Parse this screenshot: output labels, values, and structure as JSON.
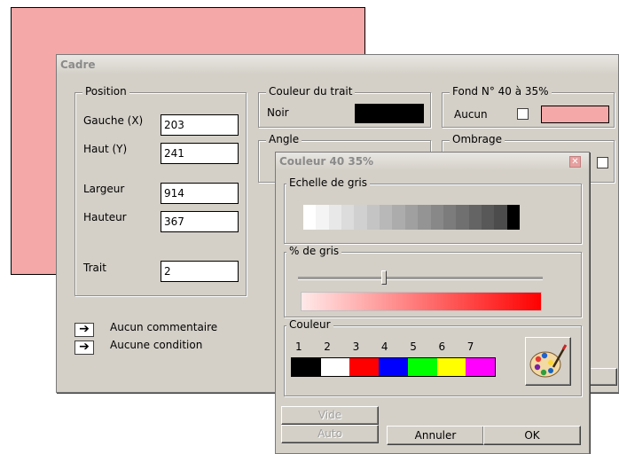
{
  "cadre": {
    "title": "Cadre",
    "position": {
      "label": "Position",
      "gauche_label": "Gauche (X)",
      "gauche_value": "203",
      "haut_label": "Haut (Y)",
      "haut_value": "241",
      "largeur_label": "Largeur",
      "largeur_value": "914",
      "hauteur_label": "Hauteur",
      "hauteur_value": "367",
      "trait_label": "Trait",
      "trait_value": "2"
    },
    "couleur_trait": {
      "label": "Couleur du trait",
      "value": "Noir",
      "swatch": "#000000"
    },
    "fond": {
      "label": "Fond N° 40 à 35%",
      "aucun_label": "Aucun",
      "swatch": "#f5a8a8"
    },
    "angle": {
      "label": "Angle"
    },
    "ombrage": {
      "label": "Ombrage"
    },
    "links": [
      "Aucun commentaire",
      "Aucune condition"
    ]
  },
  "couleur_dialog": {
    "title": "Couleur 40 35%",
    "echelle_label": "Echelle de gris",
    "gray_scale": [
      "#ffffff",
      "#f4f4f4",
      "#e8e8e8",
      "#dcdcdc",
      "#d0d0d0",
      "#c4c4c4",
      "#b8b8b8",
      "#acacac",
      "#a0a0a0",
      "#949494",
      "#888888",
      "#7c7c7c",
      "#707070",
      "#646464",
      "#585858",
      "#4c4c4c",
      "#000000"
    ],
    "pct_gris_label": "% de gris",
    "pct_gris_value": 0.35,
    "couleur_label": "Couleur",
    "color_numbers": [
      "1",
      "2",
      "3",
      "4",
      "5",
      "6",
      "7"
    ],
    "colors": [
      "#000000",
      "#ffffff",
      "#ff0000",
      "#0000ff",
      "#00ff00",
      "#ffff00",
      "#ff00ff"
    ],
    "buttons": {
      "vide": "Vide",
      "auto": "Auto",
      "annuler": "Annuler",
      "ok": "OK"
    }
  }
}
